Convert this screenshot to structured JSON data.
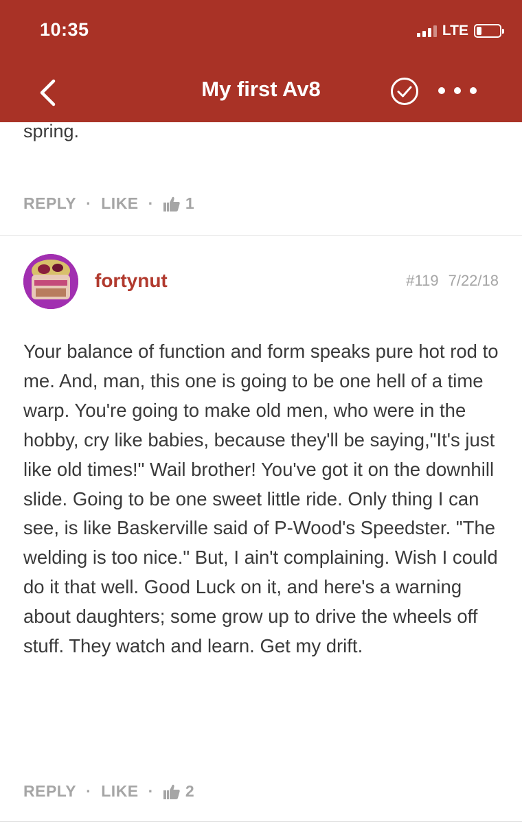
{
  "status_bar": {
    "time": "10:35",
    "network": "LTE"
  },
  "header": {
    "title": "My first Av8"
  },
  "previous_post": {
    "text_tail": "spring.",
    "actions": {
      "reply": "REPLY",
      "like": "LIKE",
      "like_count": "1"
    }
  },
  "post": {
    "username": "fortynut",
    "number": "#119",
    "date": "7/22/18",
    "body": "Your balance of function and form speaks pure hot rod to me. And, man, this one is going to be one hell of a time warp. You're going to make old men, who were in the hobby, cry like babies, because they'll be saying,\"It's just like old times!\" Wail brother! You've got it on the downhill slide. Going to be one sweet little ride. Only thing I can see, is like Baskerville said of P-Wood's Speedster. \"The welding is too nice.\" But, I ain't complaining. Wish I could do it that well. Good Luck on it, and here's a warning about daughters; some grow up to drive the wheels off stuff. They watch and learn. Get my drift.",
    "actions": {
      "reply": "REPLY",
      "like": "LIKE",
      "like_count": "2"
    }
  },
  "colors": {
    "header_bg": "#a93226",
    "username": "#b13a2e",
    "muted": "#a5a5a5"
  }
}
